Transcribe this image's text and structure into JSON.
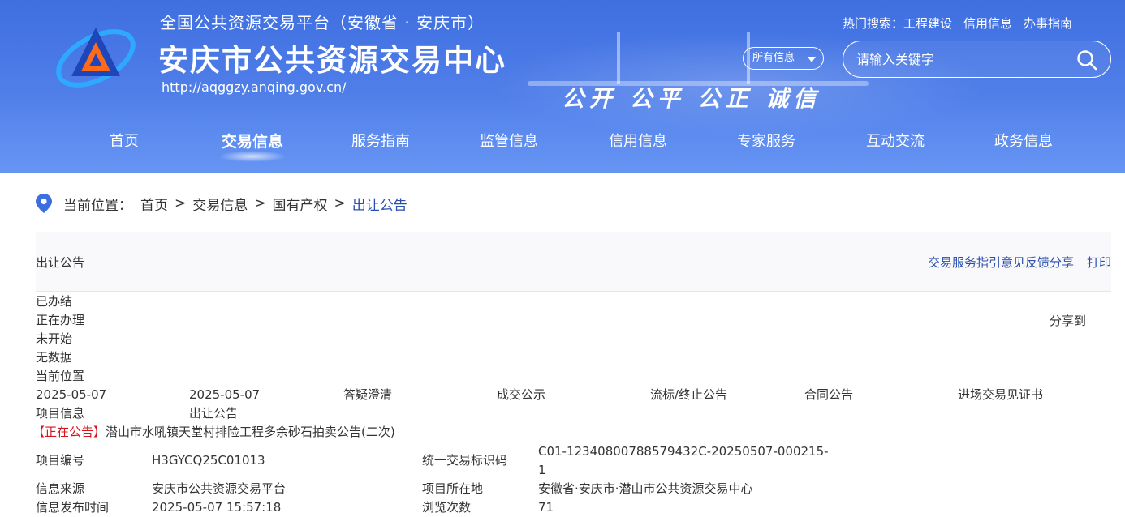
{
  "header": {
    "subtitle": "全国公共资源交易平台（安徽省 · 安庆市）",
    "title": "安庆市公共资源交易中心",
    "url": "http://aqggzy.anqing.gov.cn/",
    "slogan": "公开  公平  公正  诚信",
    "hot_label": "热门搜索：",
    "hot_items": [
      "工程建设",
      "信用信息",
      "办事指南"
    ],
    "scope_select": "所有信息",
    "search_placeholder": "请输入关键字"
  },
  "nav": {
    "items": [
      "首页",
      "交易信息",
      "服务指南",
      "监管信息",
      "信用信息",
      "专家服务",
      "互动交流",
      "政务信息"
    ],
    "active_index": 1
  },
  "breadcrumb": {
    "label": "当前位置：",
    "items": [
      "首页",
      "交易信息",
      "国有产权",
      "出让公告"
    ],
    "separator": ">"
  },
  "toolbar": {
    "title": "出让公告",
    "links_text": "交易服务指引意见反馈分享",
    "print": "打印"
  },
  "status_lines": [
    "已办结",
    "正在办理",
    "未开始",
    "无数据",
    "当前位置"
  ],
  "share_to": "分享到",
  "timeline": {
    "date1": "2025-05-07",
    "date2": "2025-05-07",
    "steps": [
      "答疑澄清",
      "成交公示",
      "流标/终止公告",
      "合同公告",
      "进场交易见证书"
    ],
    "label1": "项目信息",
    "label2": "出让公告"
  },
  "notice": {
    "status_tag": "【正在公告】",
    "title": "潜山市水吼镇天堂村排险工程多余砂石拍卖公告(二次)"
  },
  "details": {
    "project_no_label": "项目编号",
    "project_no": "H3GYCQ25C01013",
    "trade_id_label": "统一交易标识码",
    "trade_id_line1": "C01-12340800788579432C-20250507-000215-",
    "trade_id_line2": "1",
    "source_label": "信息来源",
    "source": "安庆市公共资源交易平台",
    "location_label": "项目所在地",
    "location": "安徽省·安庆市·潜山市公共资源交易中心",
    "publish_time_label": "信息发布时间",
    "publish_time": "2025-05-07 15:57:18",
    "views_label": "浏览次数",
    "views": "71"
  },
  "colors": {
    "header_blue": "#4d7ce8",
    "link_blue": "#2a4fae",
    "status_red": "#d6141c"
  }
}
